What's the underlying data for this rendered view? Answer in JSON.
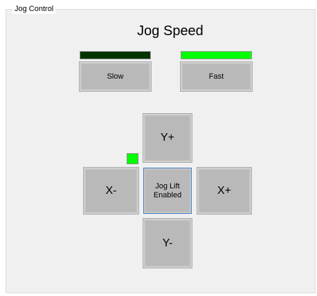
{
  "panel": {
    "legend": "Jog Control",
    "title": "Jog Speed"
  },
  "speed": {
    "slow": {
      "label": "Slow",
      "indicator_color": "#003300"
    },
    "fast": {
      "label": "Fast",
      "indicator_color": "#00ff00"
    }
  },
  "jog": {
    "y_plus": "Y+",
    "y_minus": "Y-",
    "x_plus": "X+",
    "x_minus": "X-",
    "center": "Jog Lift\nEnabled",
    "lift_indicator_color": "#00ff00"
  }
}
